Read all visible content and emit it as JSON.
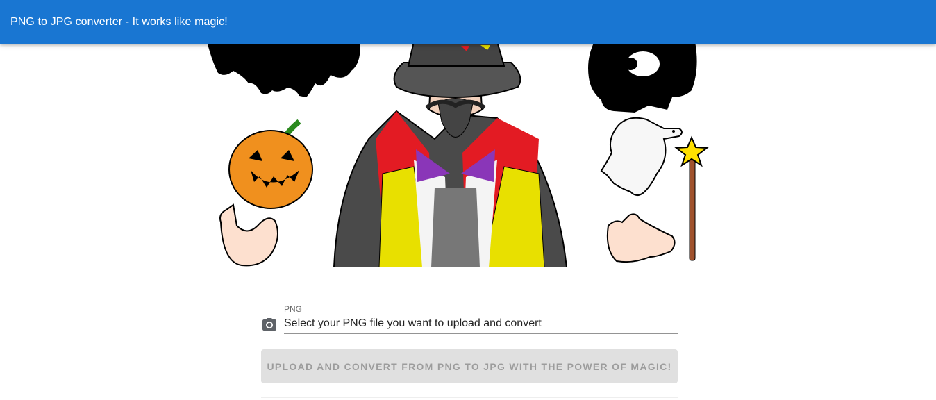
{
  "appbar": {
    "title": "PNG to JPG converter - It works like magic!"
  },
  "hero": {
    "image": "magician-illustration",
    "alt": ""
  },
  "form": {
    "field_label": "PNG",
    "input_placeholder": "Select your PNG file you want to upload and convert",
    "icon": "camera-icon",
    "button_label": "Upload and convert from PNG to JPG with the power of magic!"
  },
  "colors": {
    "appbar": "#1976d2",
    "button_disabled_bg": "#e0e0e0",
    "pumpkin": "#f0901e",
    "cape_red": "#e31b23",
    "vest_yellow": "#e8e000",
    "bow_purple": "#8a36b8"
  }
}
